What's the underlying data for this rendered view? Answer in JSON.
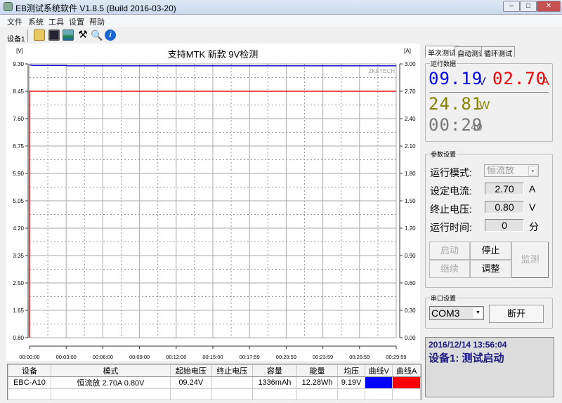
{
  "window": {
    "title": "EB测试系统软件 V1.8.5 (Build 2016-03-20)"
  },
  "menu": [
    "文件",
    "系统",
    "工具",
    "设置",
    "帮助"
  ],
  "toolbar": {
    "device_tab": "设备1",
    "icons": [
      "open-folder-icon",
      "save-icon",
      "image-icon",
      "tools-icon",
      "search-icon",
      "info-icon"
    ]
  },
  "chart_data": {
    "type": "line",
    "title": "支持MTK 新款  9V检测",
    "watermark": "ZKETECH",
    "ylabel": "[V]",
    "y2label": "[A]",
    "ylim": [
      0.8,
      9.3
    ],
    "y2lim": [
      0,
      3.0
    ],
    "yticks": [
      "9.30",
      "8.45",
      "7.60",
      "6.75",
      "5.90",
      "5.05",
      "4.20",
      "3.35",
      "2.50",
      "1.65",
      "0.80"
    ],
    "y2ticks": [
      "3.00",
      "2.70",
      "2.40",
      "2.10",
      "1.80",
      "1.50",
      "1.20",
      "0.90",
      "0.60",
      "0.30",
      "0.00"
    ],
    "xticks": [
      "00:00:00",
      "00:03:00",
      "00:06:00",
      "00:09:00",
      "00:12:00",
      "00:15:00",
      "00:17:59",
      "00:20:59",
      "00:23:59",
      "00:26:59",
      "00:29:59"
    ],
    "xlim_min": [
      0,
      30
    ],
    "grid": true,
    "series": [
      {
        "name": "V",
        "axis": "left",
        "color": "#1010c8",
        "points": [
          [
            0,
            9.27
          ],
          [
            0.3,
            9.25
          ],
          [
            3,
            9.25
          ],
          [
            3.05,
            9.24
          ],
          [
            30,
            9.24
          ]
        ]
      },
      {
        "name": "A",
        "axis": "right",
        "color": "#e01010",
        "points": [
          [
            0,
            0
          ],
          [
            0,
            2.7
          ],
          [
            30,
            2.7
          ]
        ]
      }
    ]
  },
  "table": {
    "headers": [
      "设备",
      "模式",
      "起始电压",
      "终止电压",
      "容量",
      "能量",
      "均压",
      "曲线V",
      "曲线A"
    ],
    "rows": [
      [
        "EBC-A10",
        "恒流放 2.70A 0.80V",
        "09.24V",
        "",
        "1336mAh",
        "12.28Wh",
        "9.19V",
        "",
        ""
      ]
    ],
    "curve_colors": [
      "#0000ff",
      "#ff0000"
    ]
  },
  "right": {
    "tabs": [
      "单次测试",
      "自动测试",
      "循环测试"
    ],
    "run_data": {
      "legend": "运行数据",
      "voltage": "09.19",
      "v_unit": "V",
      "current": "02.70",
      "a_unit": "A",
      "power": "24.81",
      "w_unit": "W",
      "time": "00:29",
      "time_sec": "40"
    },
    "params": {
      "legend": "参数设置",
      "mode_label": "运行模式:",
      "mode_value": "恒流放",
      "current_label": "设定电流:",
      "current_value": "2.70",
      "current_unit": "A",
      "cutoff_label": "终止电压:",
      "cutoff_value": "0.80",
      "cutoff_unit": "V",
      "time_label": "运行时间:",
      "time_value": "0",
      "time_unit": "分"
    },
    "buttons": {
      "start": "启动",
      "stop": "停止",
      "continue": "继续",
      "adjust": "调整",
      "monitor": "监测"
    },
    "serial": {
      "legend": "串口设置",
      "port": "COM3",
      "disconnect": "断开"
    },
    "status": {
      "datetime": "2016/12/14 13:56:04",
      "message": "设备1: 测试启动"
    }
  }
}
